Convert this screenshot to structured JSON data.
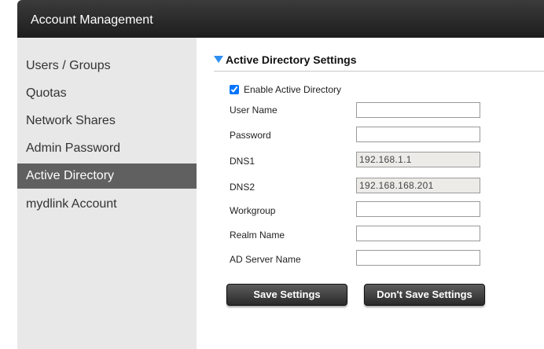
{
  "window": {
    "title": "Account Management"
  },
  "sidebar": {
    "items": [
      {
        "label": "Users / Groups",
        "active": false
      },
      {
        "label": "Quotas",
        "active": false
      },
      {
        "label": "Network Shares",
        "active": false
      },
      {
        "label": "Admin Password",
        "active": false
      },
      {
        "label": "Active Directory",
        "active": true
      },
      {
        "label": "mydlink Account",
        "active": false
      }
    ]
  },
  "section": {
    "title": "Active Directory Settings",
    "enable_label": "Enable Active Directory",
    "enabled": true
  },
  "fields": {
    "user_name": {
      "label": "User Name",
      "value": ""
    },
    "password": {
      "label": "Password",
      "value": ""
    },
    "dns1": {
      "label": "DNS1",
      "value": "192.168.1.1"
    },
    "dns2": {
      "label": "DNS2",
      "value": "192.168.168.201"
    },
    "workgroup": {
      "label": "Workgroup",
      "value": ""
    },
    "realm_name": {
      "label": "Realm Name",
      "value": ""
    },
    "ad_server_name": {
      "label": "AD Server Name",
      "value": ""
    }
  },
  "buttons": {
    "save": "Save Settings",
    "dont_save": "Don't Save Settings"
  },
  "colors": {
    "accent": "#2d8ff0",
    "active_item": "#606060",
    "titlebar": "#2a2a2a"
  }
}
